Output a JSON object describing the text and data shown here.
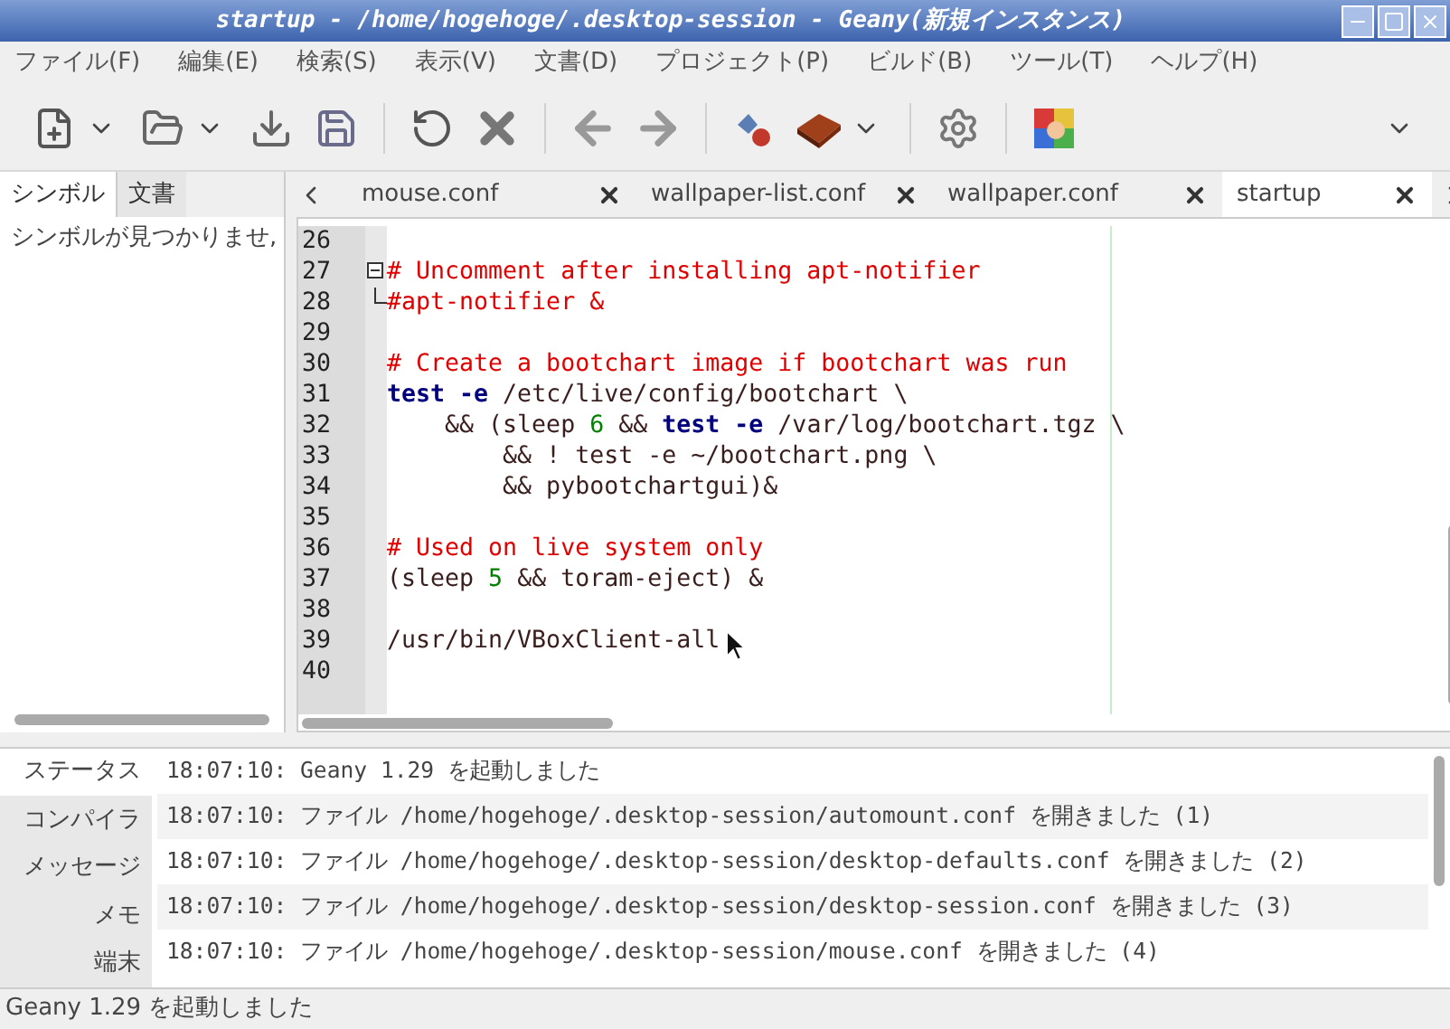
{
  "window": {
    "title": "startup - /home/hogehoge/.desktop-session - Geany(新規インスタンス)"
  },
  "menu": [
    "ファイル(F)",
    "編集(E)",
    "検索(S)",
    "表示(V)",
    "文書(D)",
    "プロジェクト(P)",
    "ビルド(B)",
    "ツール(T)",
    "ヘルプ(H)"
  ],
  "toolbar": [
    {
      "kind": "new",
      "dropdown": true
    },
    {
      "kind": "open",
      "dropdown": true
    },
    {
      "kind": "save",
      "dropdown": false
    },
    {
      "kind": "saveall",
      "dropdown": false
    },
    {
      "kind": "sep"
    },
    {
      "kind": "reload",
      "dropdown": false
    },
    {
      "kind": "close",
      "dropdown": false
    },
    {
      "kind": "sep"
    },
    {
      "kind": "back",
      "dropdown": false
    },
    {
      "kind": "forward",
      "dropdown": false
    },
    {
      "kind": "sep"
    },
    {
      "kind": "compile",
      "dropdown": false
    },
    {
      "kind": "build",
      "dropdown": true
    },
    {
      "kind": "sep"
    },
    {
      "kind": "settings",
      "dropdown": false
    },
    {
      "kind": "sep"
    },
    {
      "kind": "color",
      "dropdown": false
    }
  ],
  "sidebar": {
    "tabs": [
      {
        "label": "シンボル",
        "selected": true
      },
      {
        "label": "文書",
        "selected": false
      }
    ],
    "message": "シンボルが見つかりませ,"
  },
  "editor": {
    "tabs": [
      {
        "label": "mouse.conf",
        "selected": false
      },
      {
        "label": "wallpaper-list.conf",
        "selected": false
      },
      {
        "label": "wallpaper.conf",
        "selected": false
      },
      {
        "label": "startup",
        "selected": true
      }
    ],
    "lines": [
      {
        "number": "26",
        "fold_start": false,
        "fold_end": false
      },
      {
        "number": "27",
        "fold_start": true,
        "fold_end": false,
        "tokens": [
          {
            "kind": "comment",
            "text": "# Uncomment after installing apt-notifier"
          }
        ]
      },
      {
        "number": "28",
        "fold_start": false,
        "fold_end": true,
        "tokens": [
          {
            "kind": "comment",
            "text": "#apt-notifier &"
          }
        ]
      },
      {
        "number": "29",
        "fold_start": false,
        "fold_end": false
      },
      {
        "number": "30",
        "fold_start": false,
        "fold_end": false,
        "tokens": [
          {
            "kind": "comment",
            "text": "# Create a bootchart image if bootchart was run"
          }
        ]
      },
      {
        "number": "31",
        "fold_start": false,
        "fold_end": false,
        "tokens": [
          {
            "kind": "keyword",
            "text": "test -e"
          },
          {
            "kind": "plain",
            "text": " /etc/live/config/bootchart \\"
          }
        ]
      },
      {
        "number": "32",
        "fold_start": false,
        "fold_end": false,
        "tokens": [
          {
            "kind": "plain",
            "text": "    && (sleep "
          },
          {
            "kind": "number",
            "text": "6"
          },
          {
            "kind": "plain",
            "text": " && "
          },
          {
            "kind": "keyword",
            "text": "test -e"
          },
          {
            "kind": "plain",
            "text": " /var/log/bootchart.tgz \\"
          }
        ]
      },
      {
        "number": "33",
        "fold_start": false,
        "fold_end": false,
        "tokens": [
          {
            "kind": "plain",
            "text": "        && ! test -e ~/bootchart.png \\"
          }
        ]
      },
      {
        "number": "34",
        "fold_start": false,
        "fold_end": false,
        "tokens": [
          {
            "kind": "plain",
            "text": "        && pybootchartgui)&"
          }
        ]
      },
      {
        "number": "35",
        "fold_start": false,
        "fold_end": false
      },
      {
        "number": "36",
        "fold_start": false,
        "fold_end": false,
        "tokens": [
          {
            "kind": "comment",
            "text": "# Used on live system only"
          }
        ]
      },
      {
        "number": "37",
        "fold_start": false,
        "fold_end": false,
        "tokens": [
          {
            "kind": "plain",
            "text": "(sleep "
          },
          {
            "kind": "number",
            "text": "5"
          },
          {
            "kind": "plain",
            "text": " && toram-eject) &"
          }
        ]
      },
      {
        "number": "38",
        "fold_start": false,
        "fold_end": false
      },
      {
        "number": "39",
        "fold_start": false,
        "fold_end": false,
        "tokens": [
          {
            "kind": "plain",
            "text": "/usr/bin/VBoxClient-all"
          }
        ]
      },
      {
        "number": "40",
        "fold_start": false,
        "fold_end": false
      }
    ]
  },
  "messages": {
    "tabs": [
      {
        "label": "ステータス",
        "selected": true
      },
      {
        "label": "コンパイラ",
        "selected": false
      },
      {
        "label": "メッセージ",
        "selected": false
      },
      {
        "label": "メモ",
        "selected": false
      },
      {
        "label": "端末",
        "selected": false
      }
    ],
    "rows": [
      "18:07:10: Geany 1.29 を起動しました",
      "18:07:10: ファイル /home/hogehoge/.desktop-session/automount.conf を開きました (1)",
      "18:07:10: ファイル /home/hogehoge/.desktop-session/desktop-defaults.conf を開きました (2)",
      "18:07:10: ファイル /home/hogehoge/.desktop-session/desktop-session.conf を開きました (3)",
      "18:07:10: ファイル /home/hogehoge/.desktop-session/mouse.conf を開きました (4)"
    ]
  },
  "status_bar": "Geany 1.29 を起動しました"
}
